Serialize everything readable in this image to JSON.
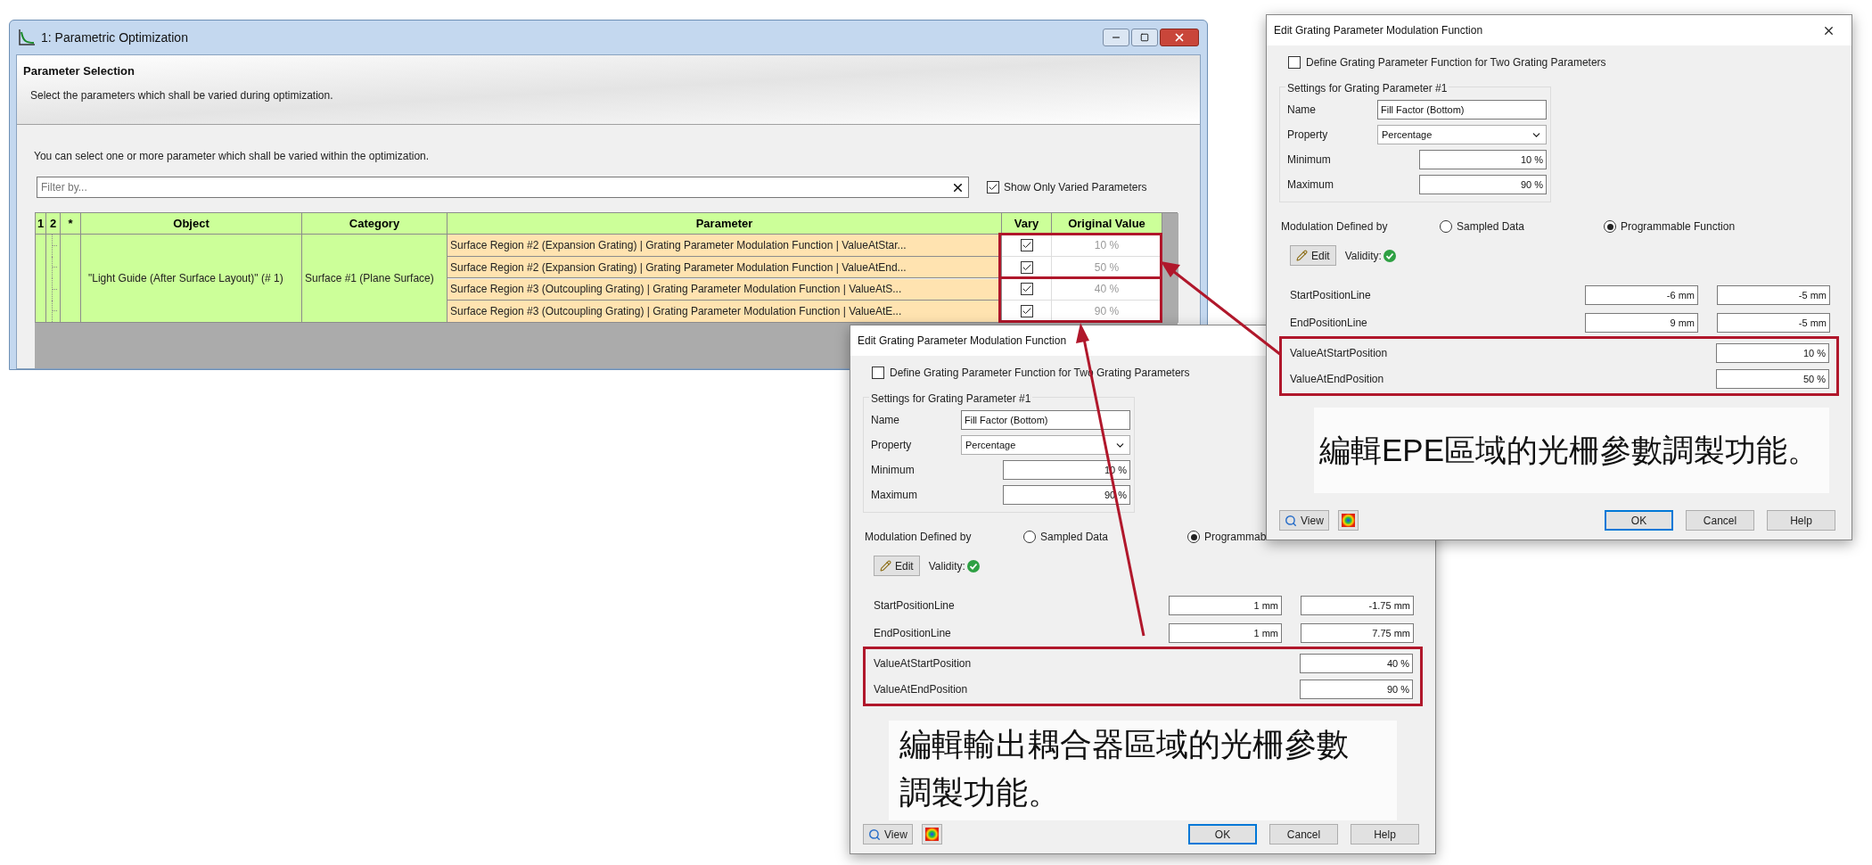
{
  "main_window": {
    "title": "1: Parametric Optimization",
    "heading": "Parameter Selection",
    "subheading": "Select the parameters which shall be varied during optimization.",
    "instruction": "You can select one or more parameter which shall be varied within the optimization.",
    "filter": {
      "placeholder": "Filter by..."
    },
    "show_only_varied": {
      "label": "Show Only Varied Parameters",
      "checked": true
    },
    "table": {
      "columns": [
        "1",
        "2",
        "*",
        "Object",
        "Category",
        "Parameter",
        "Vary",
        "Original Value"
      ],
      "object": "\"Light Guide (After Surface Layout)\" (# 1)",
      "category": "Surface #1 (Plane Surface)",
      "rows": [
        {
          "parameter": "Surface Region #2 (Expansion Grating) | Grating Parameter Modulation Function | ValueAtStar...",
          "vary": true,
          "original_value": "10 %"
        },
        {
          "parameter": "Surface Region #2 (Expansion Grating) | Grating Parameter Modulation Function | ValueAtEnd...",
          "vary": true,
          "original_value": "50 %"
        },
        {
          "parameter": "Surface Region #3 (Outcoupling Grating) | Grating Parameter Modulation Function | ValueAtS...",
          "vary": true,
          "original_value": "40 %"
        },
        {
          "parameter": "Surface Region #3 (Outcoupling Grating) | Grating Parameter Modulation Function | ValueAtE...",
          "vary": true,
          "original_value": "90 %"
        }
      ]
    }
  },
  "dialogs": [
    {
      "title": "Edit Grating Parameter Modulation Function",
      "two_parameters": {
        "label": "Define Grating Parameter Function for Two Grating Parameters",
        "checked": false
      },
      "group_title": "Settings for Grating Parameter #1",
      "fields": [
        {
          "label": "Name",
          "value": "Fill Factor (Bottom)",
          "kind": "text"
        },
        {
          "label": "Property",
          "value": "Percentage",
          "kind": "select"
        },
        {
          "label": "Minimum",
          "value": "10 %",
          "kind": "number"
        },
        {
          "label": "Maximum",
          "value": "90 %",
          "kind": "number"
        }
      ],
      "modulation_label": "Modulation Defined by",
      "modulation_options": [
        {
          "label": "Sampled Data",
          "selected": false
        },
        {
          "label": "Programmable Function",
          "selected": true
        }
      ],
      "edit_button": "Edit",
      "validity_label": "Validity:",
      "position_rows": [
        {
          "label": "StartPositionLine",
          "values": [
            "-6 mm",
            "-5 mm"
          ]
        },
        {
          "label": "EndPositionLine",
          "values": [
            "9 mm",
            "-5 mm"
          ]
        }
      ],
      "value_rows": [
        {
          "label": "ValueAtStartPosition",
          "value": "10 %"
        },
        {
          "label": "ValueAtEndPosition",
          "value": "50 %"
        }
      ],
      "caption": "編輯EPE區域的光柵參數調製功能。",
      "view_button": "View",
      "buttons": [
        {
          "label": "OK",
          "default": true
        },
        {
          "label": "Cancel",
          "default": false
        },
        {
          "label": "Help",
          "default": false
        }
      ]
    },
    {
      "title": "Edit Grating Parameter Modulation Function",
      "two_parameters": {
        "label": "Define Grating Parameter Function for Two Grating Parameters",
        "checked": false
      },
      "group_title": "Settings for Grating Parameter #1",
      "fields": [
        {
          "label": "Name",
          "value": "Fill Factor (Bottom)",
          "kind": "text"
        },
        {
          "label": "Property",
          "value": "Percentage",
          "kind": "select"
        },
        {
          "label": "Minimum",
          "value": "10 %",
          "kind": "number"
        },
        {
          "label": "Maximum",
          "value": "90 %",
          "kind": "number"
        }
      ],
      "modulation_label": "Modulation Defined by",
      "modulation_options": [
        {
          "label": "Sampled Data",
          "selected": false
        },
        {
          "label": "Programmab",
          "selected": true
        }
      ],
      "edit_button": "Edit",
      "validity_label": "Validity:",
      "position_rows": [
        {
          "label": "StartPositionLine",
          "values": [
            "1 mm",
            "-1.75 mm"
          ]
        },
        {
          "label": "EndPositionLine",
          "values": [
            "1 mm",
            "7.75 mm"
          ]
        }
      ],
      "value_rows": [
        {
          "label": "ValueAtStartPosition",
          "value": "40 %"
        },
        {
          "label": "ValueAtEndPosition",
          "value": "90 %"
        }
      ],
      "caption": "編輯輸出耦合器區域的光柵參數調製功能。",
      "view_button": "View",
      "buttons": [
        {
          "label": "OK",
          "default": true
        },
        {
          "label": "Cancel",
          "default": false
        },
        {
          "label": "Help",
          "default": false
        }
      ]
    }
  ]
}
